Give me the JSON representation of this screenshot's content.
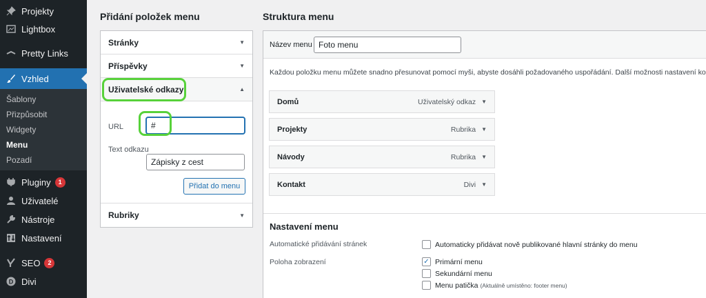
{
  "sidebar": {
    "items_top": [
      {
        "label": "Projekty",
        "icon": "pin-icon"
      },
      {
        "label": "Lightbox",
        "icon": "lightbox-icon"
      },
      {
        "label": "Pretty Links",
        "icon": "star-link-icon"
      }
    ],
    "active": {
      "label": "Vzhled",
      "icon": "brush-icon"
    },
    "submenu": [
      "Šablony",
      "Přizpůsobit",
      "Widgety",
      "Menu",
      "Pozadí"
    ],
    "current_submenu": "Menu",
    "items_bottom": [
      {
        "label": "Pluginy",
        "icon": "plug-icon",
        "badge": "1"
      },
      {
        "label": "Uživatelé",
        "icon": "user-icon",
        "badge": ""
      },
      {
        "label": "Nástroje",
        "icon": "wrench-icon",
        "badge": ""
      },
      {
        "label": "Nastavení",
        "icon": "settings-icon",
        "badge": ""
      },
      {
        "label": "SEO",
        "icon": "yoast-icon",
        "badge": "2"
      },
      {
        "label": "Divi",
        "icon": "divi-icon",
        "badge": ""
      }
    ]
  },
  "left": {
    "heading": "Přidání položek menu",
    "sections": [
      "Stránky",
      "Příspěvky",
      "Uživatelské odkazy",
      "Rubriky"
    ],
    "url_label": "URL",
    "url_value": "#",
    "text_label": "Text odkazu",
    "text_value": "Zápisky z cest",
    "add_button": "Přidat do menu"
  },
  "right": {
    "heading": "Struktura menu",
    "name_label": "Název menu",
    "name_value": "Foto menu",
    "instructions": "Každou položku menu můžete snadno přesunovat pomocí myši, abyste dosáhli požadovaného uspořádání. Další možnosti nastavení konk",
    "menu_items": [
      {
        "title": "Domů",
        "type": "Uživatelský odkaz"
      },
      {
        "title": "Projekty",
        "type": "Rubrika"
      },
      {
        "title": "Návody",
        "type": "Rubrika"
      },
      {
        "title": "Kontakt",
        "type": "Divi"
      }
    ],
    "settings_heading": "Nastavení menu",
    "auto_add_label": "Automatické přidávání stránek",
    "auto_add_option": "Automaticky přidávat nově publikované hlavní stránky do menu",
    "location_label": "Poloha zobrazení",
    "locations": [
      {
        "label": "Primární menu",
        "checked": true,
        "note": ""
      },
      {
        "label": "Sekundární menu",
        "checked": false,
        "note": ""
      },
      {
        "label": "Menu patička",
        "checked": false,
        "note": "(Aktuálně umístěno: footer menu)"
      }
    ]
  },
  "colors": {
    "accent": "#2271b1",
    "highlight": "#57d13a",
    "sidebar": "#1d2327",
    "badge": "#d63638"
  }
}
